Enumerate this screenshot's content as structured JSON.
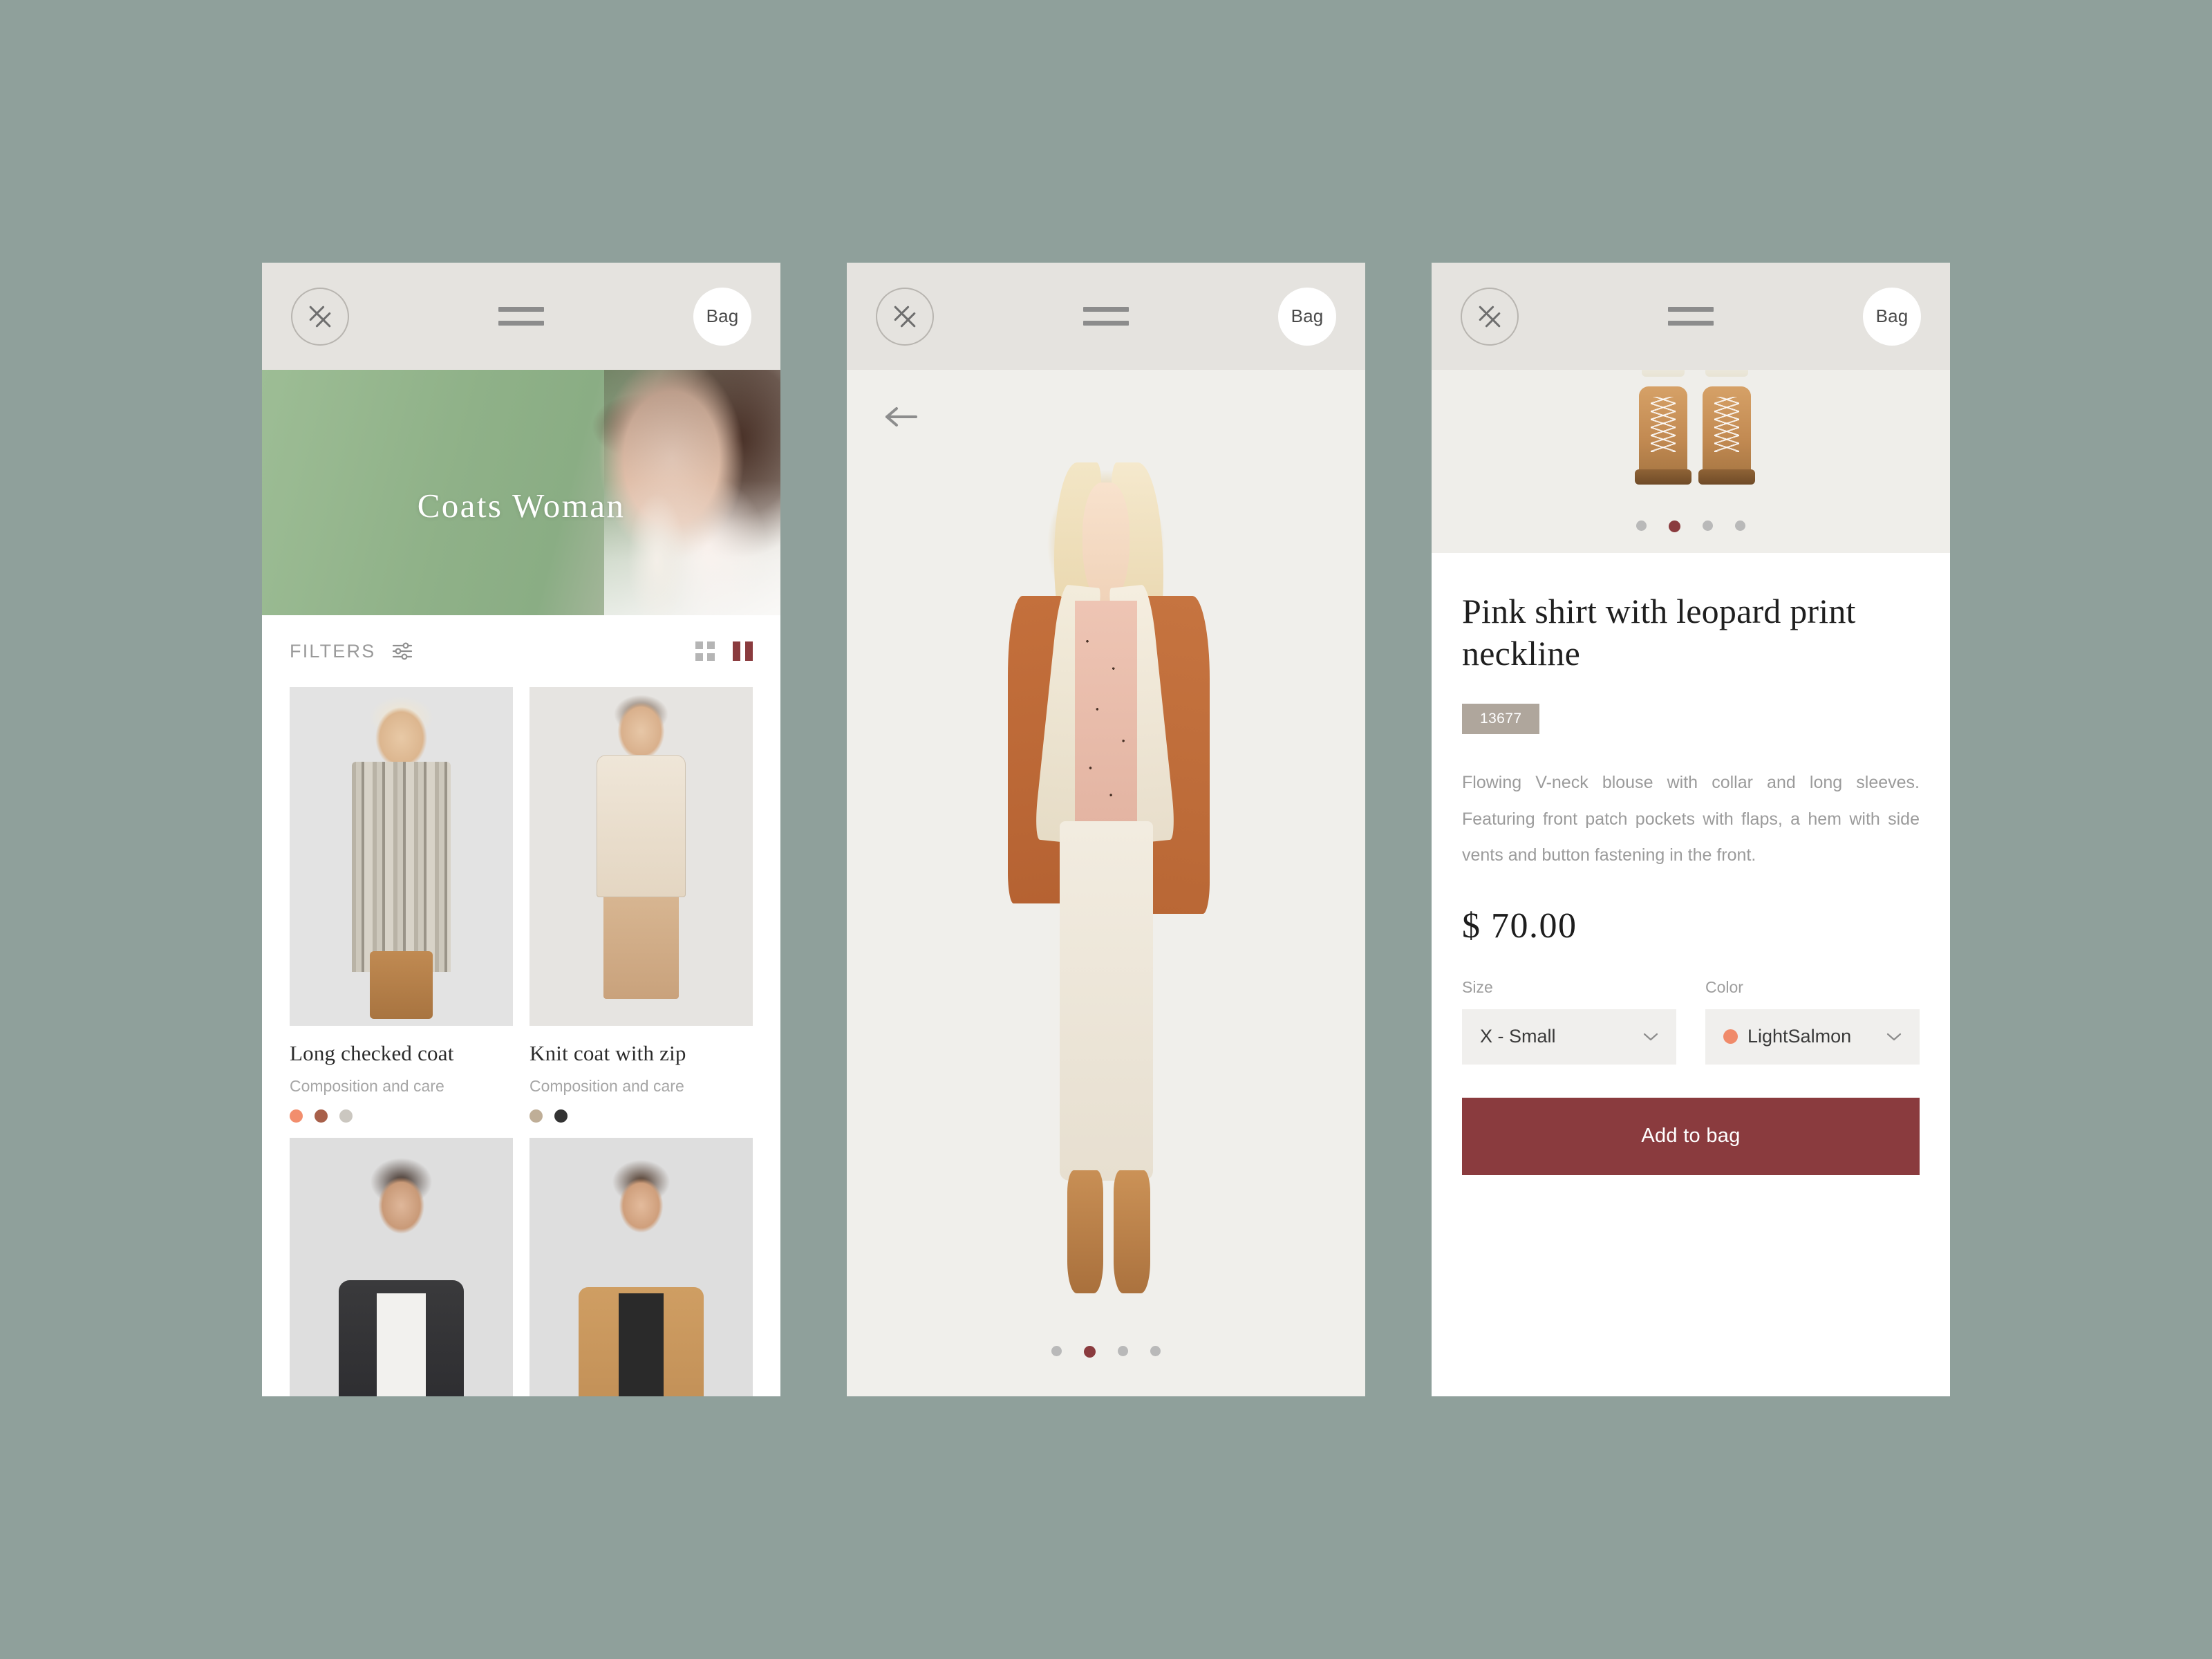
{
  "app": {
    "logo_icon": "double-x-logo-icon",
    "menu_icon": "hamburger-menu-icon",
    "bag_label": "Bag"
  },
  "screens": {
    "catalog": {
      "hero_title": "Coats Woman",
      "filters": {
        "label": "FILTERS",
        "settings_icon": "sliders-icon",
        "view_grid_icon": "grid-view-icon",
        "view_columns_icon": "two-column-view-icon"
      },
      "products": [
        {
          "name": "Long checked coat",
          "subtitle": "Composition and care",
          "swatches": [
            "#f28e6d",
            "#a8604a",
            "#cbc7c0"
          ]
        },
        {
          "name": "Knit coat with zip",
          "subtitle": "Composition and care",
          "swatches": [
            "#bfae97",
            "#333333"
          ]
        },
        {
          "name": "",
          "subtitle": "",
          "swatches": []
        },
        {
          "name": "",
          "subtitle": "",
          "swatches": []
        }
      ]
    },
    "product_photo": {
      "back_icon": "arrow-left-icon",
      "carousel": {
        "total": 4,
        "active_index": 1
      }
    },
    "product_detail": {
      "carousel": {
        "total": 4,
        "active_index": 1
      },
      "title": "Pink shirt with leopard print neckline",
      "sku": "13677",
      "description": "Flowing V-neck blouse with collar and long sleeves. Featuring front patch pockets with flaps, a hem with side vents and button fastening in the front.",
      "price": "$ 70.00",
      "size": {
        "label": "Size",
        "value": "X - Small",
        "chevron_icon": "chevron-down-icon"
      },
      "color": {
        "label": "Color",
        "value": "LightSalmon",
        "swatch": "#f08a6a",
        "chevron_icon": "chevron-down-icon"
      },
      "add_to_bag_label": "Add to bag"
    }
  },
  "theme": {
    "background": "#8fa09b",
    "appbar": "#e5e3df",
    "accent": "#8a3b3e",
    "sku_badge": "#afa69c",
    "hero_green": "#8fb188"
  }
}
